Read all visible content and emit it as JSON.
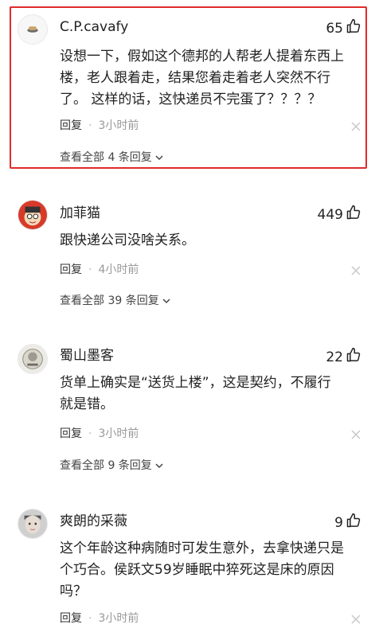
{
  "comments": [
    {
      "username": "C.P.cavafy",
      "likes": "65",
      "content_lines": [
        "设想一下，假如这个德邦的人帮老人提着东西上",
        "楼，老人跟着走，结果您着走着老人突然不行",
        "了。 这样的话，这快递员不完蛋了？？？？"
      ],
      "reply_label": "回复",
      "time": "3小时前",
      "view_all": "查看全部 4 条回复",
      "highlighted": true
    },
    {
      "username": "加菲猫",
      "likes": "449",
      "content_lines": [
        "跟快递公司没啥关系。"
      ],
      "reply_label": "回复",
      "time": "4小时前",
      "view_all": "查看全部 39 条回复",
      "highlighted": false
    },
    {
      "username": "蜀山墨客",
      "likes": "22",
      "content_lines": [
        "货单上确实是“送货上楼”，这是契约，不履行",
        "就是错。"
      ],
      "reply_label": "回复",
      "time": "3小时前",
      "view_all": "查看全部 9 条回复",
      "highlighted": false
    },
    {
      "username": "爽朗的采薇",
      "likes": "9",
      "content_lines": [
        "这个年龄这种病随时可发生意外，去拿快递只是",
        "个巧合。侯跃文59岁睡眠中猝死这是床的原因",
        "吗？"
      ],
      "reply_label": "回复",
      "time": "3小时前",
      "view_all": "",
      "highlighted": false
    }
  ],
  "colors": {
    "highlight_border": "#e02b2b",
    "meta_text": "#999999",
    "body_text": "#222222"
  },
  "icons": {
    "like": "thumbs-up-icon",
    "close": "close-icon",
    "chevron": "chevron-down-icon"
  }
}
